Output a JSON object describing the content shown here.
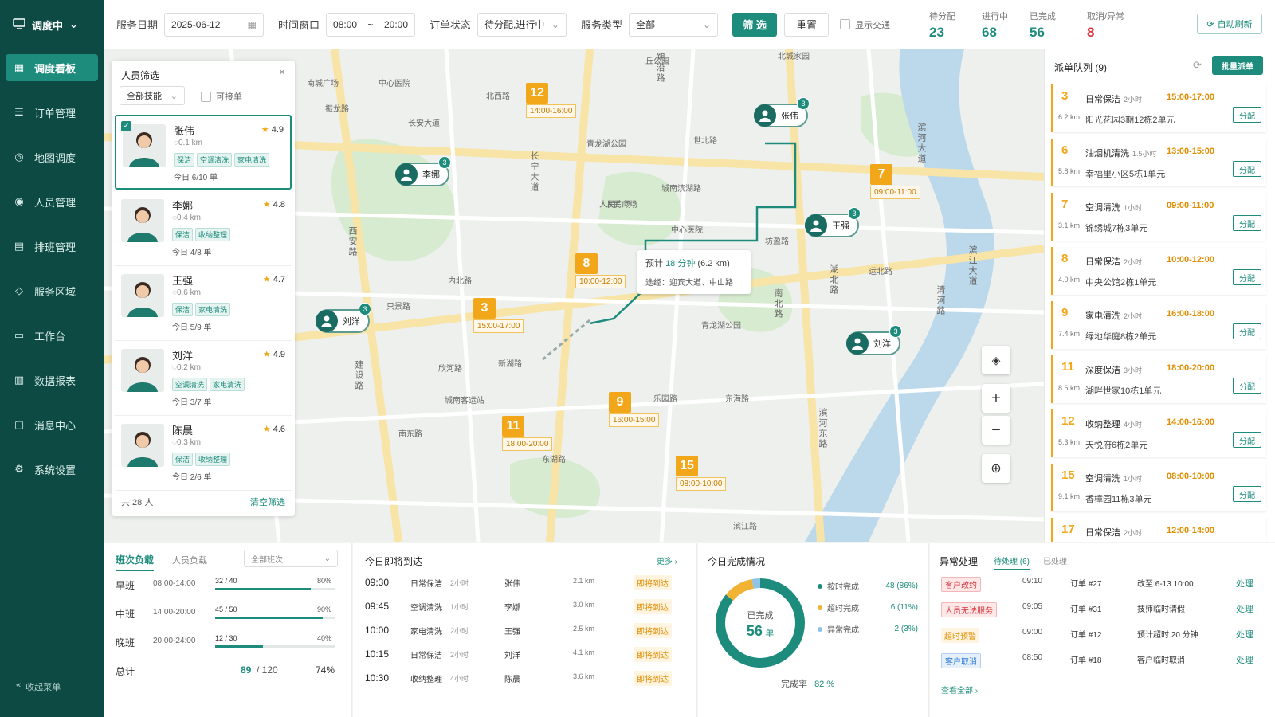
{
  "brand": {
    "label": "调度中"
  },
  "nav": [
    {
      "label": "调度看板"
    },
    {
      "label": "订单管理"
    },
    {
      "label": "地图调度"
    },
    {
      "label": "人员管理"
    },
    {
      "label": "排班管理"
    },
    {
      "label": "服务区域"
    },
    {
      "label": "工作台"
    },
    {
      "label": "数据报表"
    },
    {
      "label": "消息中心"
    },
    {
      "label": "系统设置"
    }
  ],
  "collapse_label": "收起菜单",
  "filters": {
    "date_label": "服务日期",
    "date_value": "2025-06-12",
    "window_label": "时间窗口",
    "window_start": "08:00",
    "window_sep": "~",
    "window_end": "20:00",
    "status_label": "订单状态",
    "status_value": "待分配,进行中",
    "type_label": "服务类型",
    "type_value": "全部",
    "filter_btn": "筛 选",
    "reset_btn": "重置",
    "traffic_label": "显示交通"
  },
  "stats": [
    {
      "label": "待分配",
      "value": "23",
      "color": "#1d8c7d"
    },
    {
      "label": "进行中",
      "value": "68",
      "color": "#1d8c7d"
    },
    {
      "label": "已完成",
      "value": "56",
      "color": "#1d8c7d"
    },
    {
      "label": "取消/异常",
      "value": "8",
      "color": "#d9363e"
    }
  ],
  "auto_refresh": "自动刷新",
  "person_panel": {
    "title": "人员筛选",
    "skill_select": "全部技能",
    "available_label": "可接单",
    "total": "共 28 人",
    "clear": "清空筛选",
    "people": [
      {
        "name": "张伟",
        "rating": "4.9",
        "dist": "0.1 km",
        "tags": [
          "保洁",
          "空调清洗",
          "家电清洗"
        ],
        "orders": "今日 6/10 单",
        "selected": true
      },
      {
        "name": "李娜",
        "rating": "4.8",
        "dist": "0.4 km",
        "tags": [
          "保洁",
          "收纳整理"
        ],
        "orders": "今日 4/8 单"
      },
      {
        "name": "王强",
        "rating": "4.7",
        "dist": "0.6 km",
        "tags": [
          "保洁",
          "家电清洗"
        ],
        "orders": "今日 5/9 单"
      },
      {
        "name": "刘洋",
        "rating": "4.9",
        "dist": "0.2 km",
        "tags": [
          "空调清洗",
          "家电清洗"
        ],
        "orders": "今日 3/7 单"
      },
      {
        "name": "陈晨",
        "rating": "4.6",
        "dist": "0.3 km",
        "tags": [
          "保洁",
          "收纳整理"
        ],
        "orders": "今日 2/6 单"
      }
    ]
  },
  "map": {
    "labels": [
      "南城广场",
      "中心医院",
      "振龙路",
      "长安大道",
      "北西路",
      "青龙湖公园",
      "世北路",
      "人民广场",
      "城南滨湖路",
      "中心医院",
      "坊盈路",
      "人民广场",
      "内北路",
      "只景路",
      "乐园路",
      "青龙湖公园",
      "城南客运站",
      "东湖路",
      "欣河路",
      "南东路",
      "新湖路",
      "东海路",
      "滨江路",
      "北城家园",
      "丘公园",
      "运北路"
    ],
    "vertical_labels": [
      "朔沿路",
      "长宁大道",
      "西安路",
      "建设路",
      "滨河大道",
      "清河路",
      "湖北路",
      "南北路",
      "滨江大道",
      "滨河东路"
    ],
    "route_tooltip": {
      "eta_prefix": "预计",
      "eta": "18 分钟",
      "dist": "(6.2 km)",
      "via": "途经：迎宾大道、中山路"
    },
    "orders": [
      {
        "num": "12",
        "time": "14:00-16:00"
      },
      {
        "num": "7",
        "time": "09:00-11:00"
      },
      {
        "num": "8",
        "time": "10:00-12:00"
      },
      {
        "num": "3",
        "time": "15:00-17:00"
      },
      {
        "num": "9",
        "time": "16:00-15:00"
      },
      {
        "num": "11",
        "time": "18:00-20:00"
      },
      {
        "num": "15",
        "time": "08:00-10:00"
      }
    ],
    "workers": [
      {
        "name": "张伟",
        "count": "3"
      },
      {
        "name": "李娜",
        "count": "3"
      },
      {
        "name": "王强",
        "count": "3"
      },
      {
        "name": "刘洋",
        "count": "3"
      },
      {
        "name": "刘洋",
        "count": "3"
      }
    ]
  },
  "queue": {
    "title": "派单队列 (9)",
    "batch_btn": "批量派单",
    "assign_label": "分配",
    "items": [
      {
        "num": "3",
        "type": "日常保洁",
        "dur": "2小时",
        "time": "15:00-17:00",
        "dist": "6.2 km",
        "addr": "阳光花园3期12栋2单元"
      },
      {
        "num": "6",
        "type": "油烟机清洗",
        "dur": "1.5小时",
        "time": "13:00-15:00",
        "dist": "5.8 km",
        "addr": "幸福里小区5栋1单元"
      },
      {
        "num": "7",
        "type": "空调清洗",
        "dur": "1小时",
        "time": "09:00-11:00",
        "dist": "3.1 km",
        "addr": "锦绣城7栋3单元"
      },
      {
        "num": "8",
        "type": "日常保洁",
        "dur": "2小时",
        "time": "10:00-12:00",
        "dist": "4.0 km",
        "addr": "中央公馆2栋1单元"
      },
      {
        "num": "9",
        "type": "家电清洗",
        "dur": "2小时",
        "time": "16:00-18:00",
        "dist": "7.4 km",
        "addr": "绿地华庭8栋2单元"
      },
      {
        "num": "11",
        "type": "深度保洁",
        "dur": "3小时",
        "time": "18:00-20:00",
        "dist": "8.6 km",
        "addr": "湖畔世家10栋1单元"
      },
      {
        "num": "12",
        "type": "收纳整理",
        "dur": "4小时",
        "time": "14:00-16:00",
        "dist": "5.3 km",
        "addr": "天悦府6栋2单元"
      },
      {
        "num": "15",
        "type": "空调清洗",
        "dur": "1小时",
        "time": "08:00-10:00",
        "dist": "9.1 km",
        "addr": "香樟园11栋3单元"
      },
      {
        "num": "17",
        "type": "日常保洁",
        "dur": "2小时",
        "time": "12:00-14:00",
        "dist": "",
        "addr": ""
      }
    ]
  },
  "shift": {
    "tab_active": "班次负载",
    "tab_other": "人员负载",
    "select": "全部班次",
    "rows": [
      {
        "name": "早班",
        "time": "08:00-14:00",
        "load": "32 / 40",
        "pct": "80%",
        "fill": 0.8
      },
      {
        "name": "中班",
        "time": "14:00-20:00",
        "load": "45 / 50",
        "pct": "90%",
        "fill": 0.9
      },
      {
        "name": "晚班",
        "time": "20:00-24:00",
        "load": "12 / 30",
        "pct": "40%",
        "fill": 0.4
      }
    ],
    "total_label": "总计",
    "total_value": "89",
    "total_cap": "/ 120",
    "total_pct": "74%"
  },
  "arrivals": {
    "title": "今日即将到达",
    "more": "更多 ›",
    "rows": [
      {
        "time": "09:30",
        "type": "日常保洁",
        "dur": "2小时",
        "name": "张伟",
        "dist": "2.1 km",
        "status": "即将到达"
      },
      {
        "time": "09:45",
        "type": "空调清洗",
        "dur": "1小时",
        "name": "李娜",
        "dist": "3.0 km",
        "status": "即将到达"
      },
      {
        "time": "10:00",
        "type": "家电清洗",
        "dur": "2小时",
        "name": "王强",
        "dist": "2.5 km",
        "status": "即将到达"
      },
      {
        "time": "10:15",
        "type": "日常保洁",
        "dur": "2小时",
        "name": "刘洋",
        "dist": "4.1 km",
        "status": "即将到达"
      },
      {
        "time": "10:30",
        "type": "收纳整理",
        "dur": "4小时",
        "name": "陈晨",
        "dist": "3.6 km",
        "status": "即将到达"
      }
    ]
  },
  "completion": {
    "title": "今日完成情况",
    "center_label": "已完成",
    "center_value": "56",
    "center_unit": "单",
    "legend": [
      {
        "label": "按时完成",
        "value": "48 (86%)",
        "color": "#1d8c7d",
        "frac": 0.86
      },
      {
        "label": "超时完成",
        "value": "6 (11%)",
        "color": "#f2b233",
        "frac": 0.11
      },
      {
        "label": "异常完成",
        "value": "2 (3%)",
        "color": "#8fc4e8",
        "frac": 0.03
      }
    ],
    "rate_label": "完成率",
    "rate_value": "82 %"
  },
  "exceptions": {
    "title": "异常处理",
    "tab_pending": "待处理 (6)",
    "tab_done": "已处理",
    "action": "处理",
    "view_all": "查看全部 ›",
    "rows": [
      {
        "tag": "客户改约",
        "style": "r",
        "time": "09:10",
        "order": "订单 #27",
        "desc": "改至 6-13 10:00"
      },
      {
        "tag": "人员无法服务",
        "style": "r",
        "time": "09:05",
        "order": "订单 #31",
        "desc": "技师临时请假"
      },
      {
        "tag": "超时预警",
        "style": "o",
        "time": "09:00",
        "order": "订单 #12",
        "desc": "预计超时 20 分钟"
      },
      {
        "tag": "客户取消",
        "style": "b",
        "time": "08:50",
        "order": "订单 #18",
        "desc": "客户临时取消"
      }
    ]
  }
}
